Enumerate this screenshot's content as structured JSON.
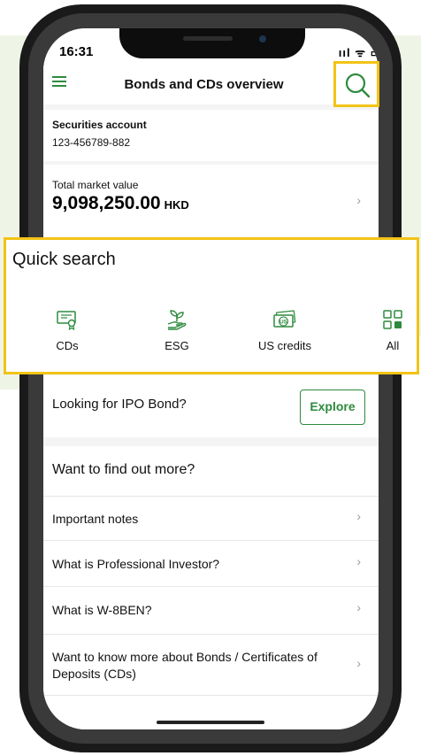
{
  "status": {
    "time": "16:31",
    "icons": "ııl ᯤ ▭"
  },
  "appbar": {
    "title": "Bonds and CDs overview"
  },
  "account": {
    "label": "Securities account",
    "number": "123-456789-882"
  },
  "market_value": {
    "label": "Total market value",
    "amount": "9,098,250.00",
    "currency": "HKD"
  },
  "quick_search": {
    "title": "Quick search",
    "items": [
      {
        "label": "CDs",
        "icon": "certificate-icon"
      },
      {
        "label": "ESG",
        "icon": "plant-hand-icon"
      },
      {
        "label": "US credits",
        "icon": "us-banknote-icon"
      },
      {
        "label": "All",
        "icon": "grid-icon"
      }
    ]
  },
  "ipo": {
    "label": "Looking for IPO Bond?",
    "button": "Explore"
  },
  "more": {
    "title": "Want to find out more?",
    "links": [
      "Important notes",
      "What is Professional Investor?",
      "What is W-8BEN?",
      "Want to know more about Bonds / Certificates of Deposits (CDs)"
    ]
  },
  "colors": {
    "accent": "#2e8b3e",
    "highlight": "#f2c316",
    "background": "#eef5e6"
  }
}
